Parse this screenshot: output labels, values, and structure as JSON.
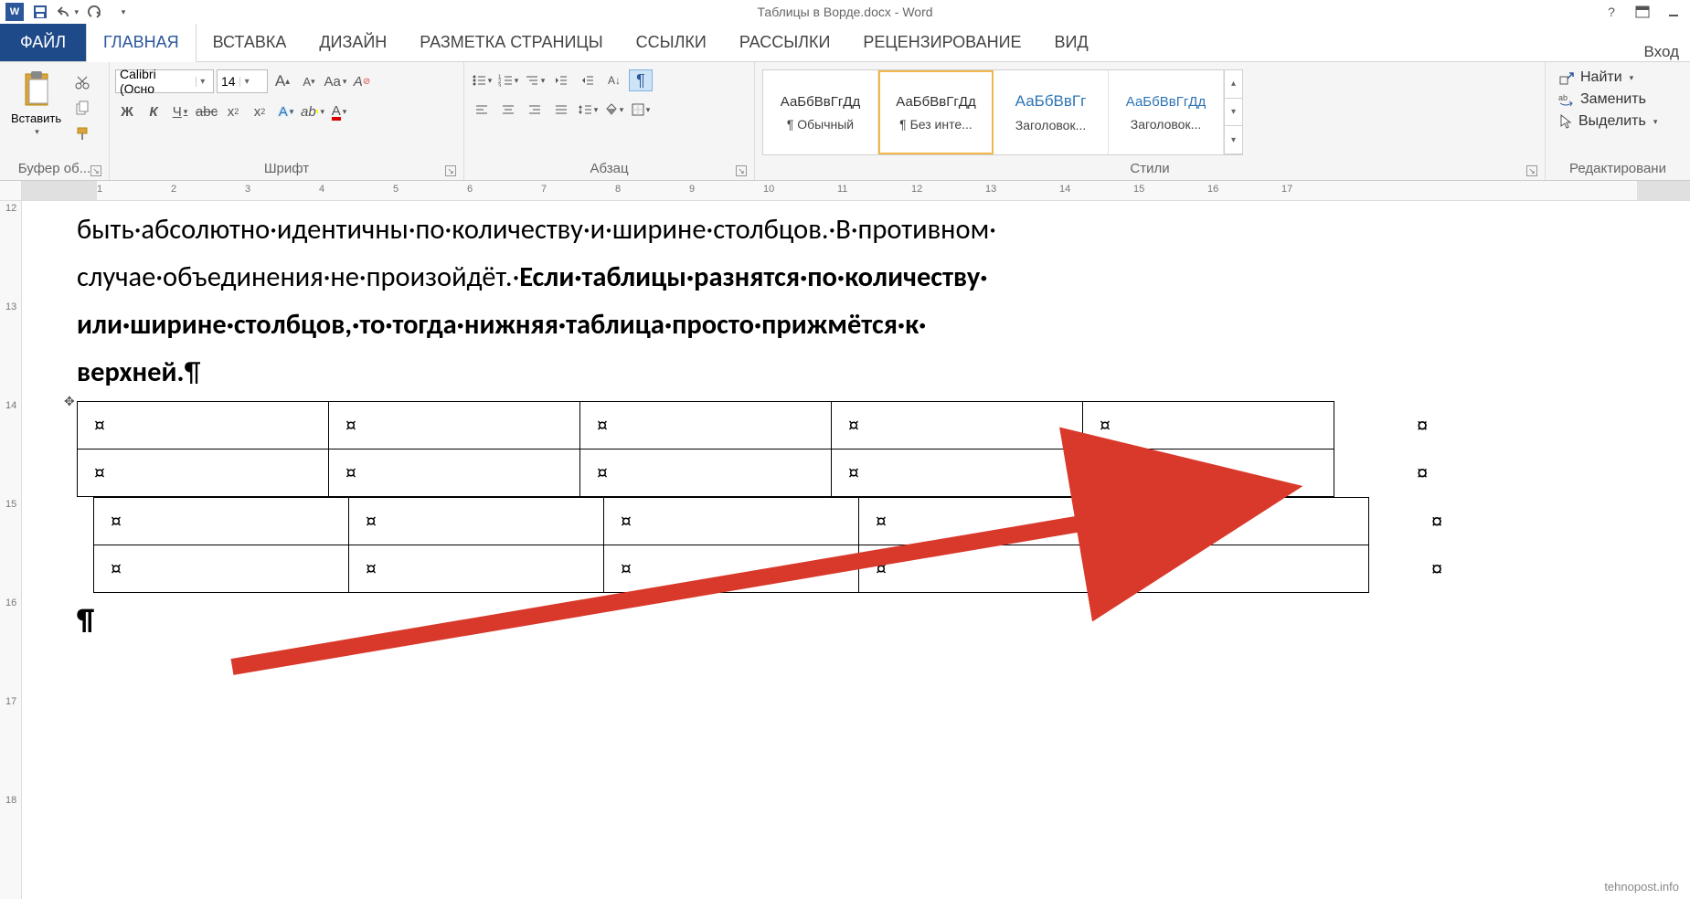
{
  "titlebar": {
    "app_icon": "W",
    "title": "Таблицы в Ворде.docx - Word",
    "login": "Вход"
  },
  "tabs": {
    "file": "ФАЙЛ",
    "home": "ГЛАВНАЯ",
    "insert": "ВСТАВКА",
    "design": "ДИЗАЙН",
    "layout": "РАЗМЕТКА СТРАНИЦЫ",
    "references": "ССЫЛКИ",
    "mailings": "РАССЫЛКИ",
    "review": "РЕЦЕНЗИРОВАНИЕ",
    "view": "ВИД"
  },
  "ribbon": {
    "clipboard": {
      "paste": "Вставить",
      "label": "Буфер об..."
    },
    "font": {
      "name": "Calibri (Осно",
      "size": "14",
      "bold": "Ж",
      "italic": "К",
      "underline": "Ч",
      "strike": "abc",
      "sub": "x₂",
      "sup": "x²",
      "label": "Шрифт"
    },
    "paragraph": {
      "label": "Абзац",
      "pilcrow": "¶"
    },
    "styles": {
      "label": "Стили",
      "items": [
        {
          "sample": "АаБбВвГгДд",
          "name": "¶ Обычный"
        },
        {
          "sample": "АаБбВвГгДд",
          "name": "¶ Без инте..."
        },
        {
          "sample": "АаБбВвГг",
          "name": "Заголовок..."
        },
        {
          "sample": "АаБбВвГгДд",
          "name": "Заголовок..."
        }
      ]
    },
    "editing": {
      "find": "Найти",
      "replace": "Заменить",
      "select": "Выделить",
      "label": "Редактировани"
    }
  },
  "ruler": {
    "h_ticks": [
      "1",
      "2",
      "3",
      "4",
      "5",
      "6",
      "7",
      "8",
      "9",
      "10",
      "11",
      "12",
      "13",
      "14",
      "15",
      "16",
      "17"
    ],
    "v_ticks": [
      "12",
      "13",
      "14",
      "15",
      "16",
      "17",
      "18"
    ]
  },
  "document": {
    "line1": "быть·абсолютно·идентичны·по·количеству·и·ширине·столбцов.·В·противном·",
    "line2a": "случае·объединения·не·произойдёт.·",
    "line2b": "Если·таблицы·разнятся·по·количеству·",
    "line3": "или·ширине·столбцов,·то·тогда·нижняя·таблица·просто·прижмётся·к·",
    "line4": "верхней.",
    "pilcrow": "¶",
    "cell_mark": "¤",
    "table1": {
      "rows": 2,
      "cols": 5
    },
    "table2": {
      "rows": 2,
      "cols": 5
    },
    "after_para": "¶"
  },
  "watermark": "tehnopost.info"
}
